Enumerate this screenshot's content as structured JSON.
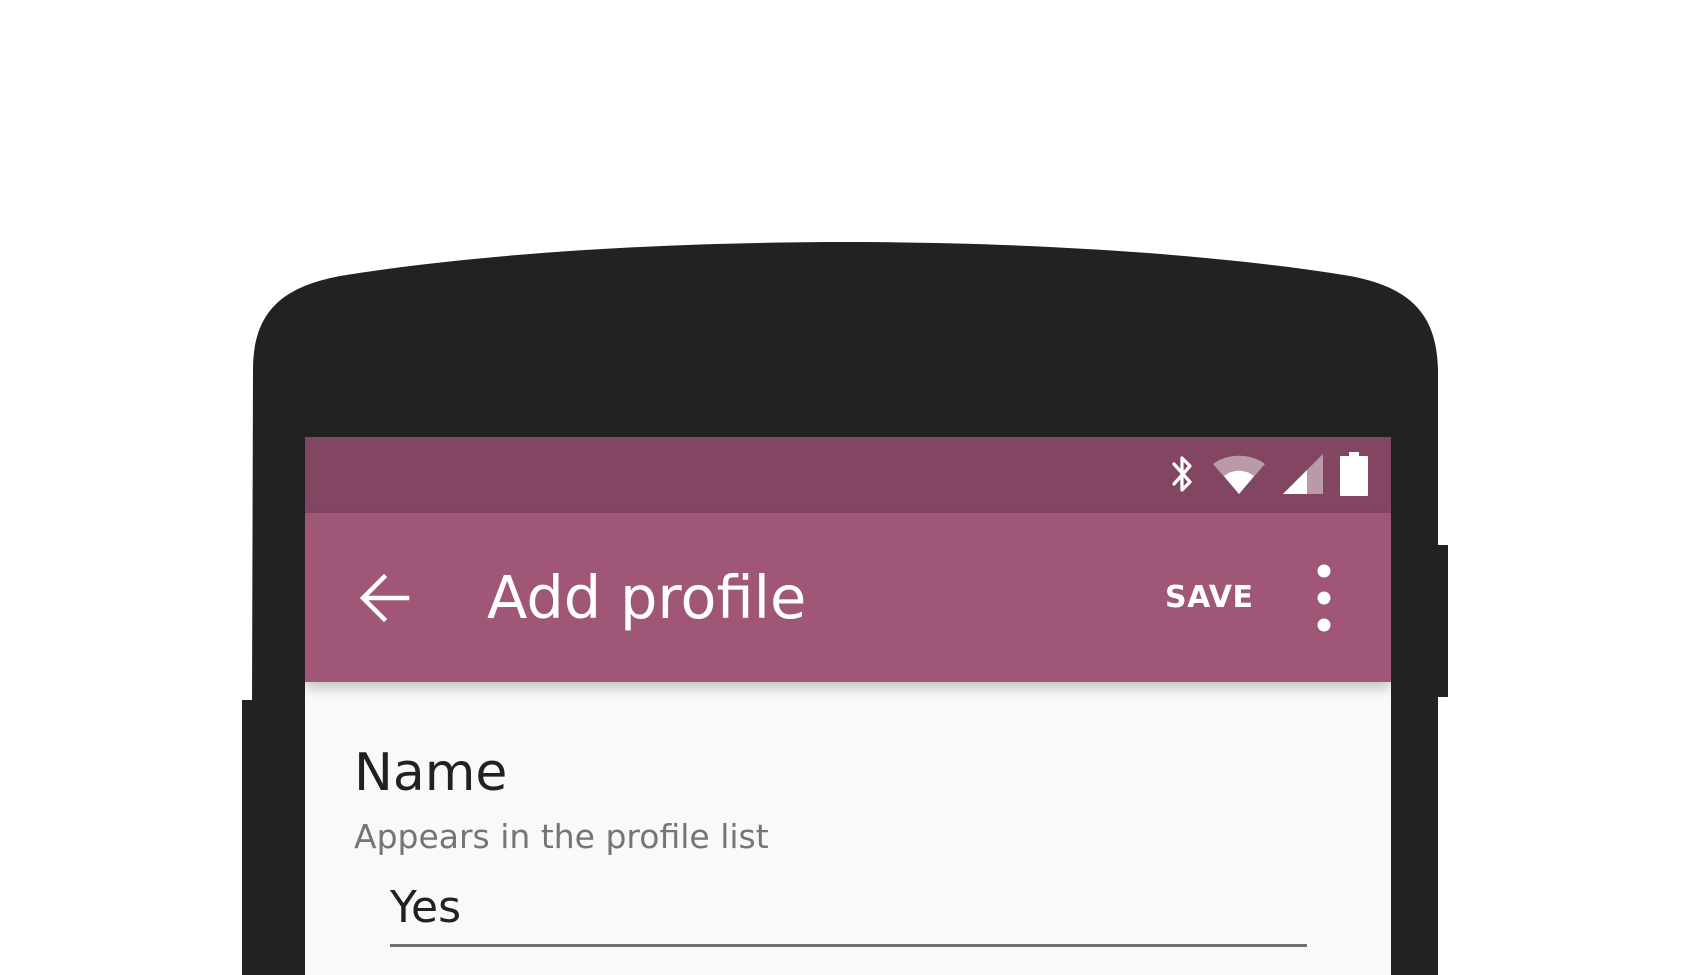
{
  "colors": {
    "statusbar": "#824663",
    "appbar": "#a05677",
    "device": "#222222",
    "screen_background": "#f9f9f9",
    "on_primary": "#ffffff",
    "input_underline": "#6e6e6e"
  },
  "statusbar": {
    "icons": [
      "bluetooth-icon",
      "wifi-icon",
      "cellular-signal-icon",
      "battery-icon"
    ]
  },
  "appbar": {
    "back_icon": "arrow-back-icon",
    "title": "Add profile",
    "save_label": "SAVE",
    "overflow_icon": "more-vert-icon"
  },
  "form": {
    "name_field": {
      "label": "Name",
      "helper": "Appears in the profile list",
      "value": "Yes"
    }
  }
}
